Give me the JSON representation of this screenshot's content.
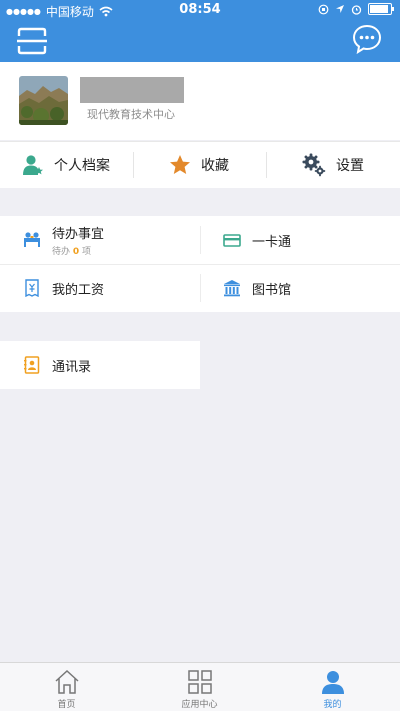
{
  "status_bar": {
    "carrier": "中国移动",
    "time": "08:54"
  },
  "profile": {
    "org": "现代教育技术中心"
  },
  "quick_actions": [
    {
      "label": "个人档案",
      "icon": "person-profile-icon"
    },
    {
      "label": "收藏",
      "icon": "star-icon"
    },
    {
      "label": "设置",
      "icon": "gear-icon"
    }
  ],
  "services": {
    "todo": {
      "label": "待办事宜",
      "sub_prefix": "待办",
      "count": "0",
      "sub_suffix": "项"
    },
    "card": {
      "label": "一卡通"
    },
    "salary": {
      "label": "我的工资"
    },
    "library": {
      "label": "图书馆"
    }
  },
  "contacts": {
    "label": "通讯录"
  },
  "tabbar": [
    {
      "label": "首页",
      "icon": "home-icon"
    },
    {
      "label": "应用中心",
      "icon": "apps-grid-icon"
    },
    {
      "label": "我的",
      "icon": "user-icon",
      "active": true
    }
  ],
  "colors": {
    "brand": "#3d8fde",
    "accent_count": "#f0a020",
    "star": "#e3892b"
  }
}
